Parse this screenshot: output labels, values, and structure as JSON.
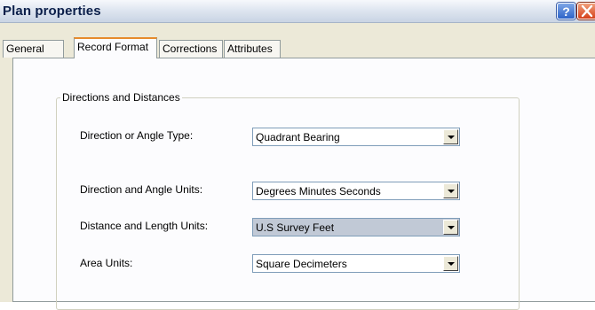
{
  "window": {
    "title": "Plan properties",
    "help_glyph": "?",
    "close_icon": "close-icon"
  },
  "tabs": [
    {
      "label": "General",
      "active": false
    },
    {
      "label": "Record Format",
      "active": true
    },
    {
      "label": "Corrections",
      "active": false
    },
    {
      "label": "Attributes",
      "active": false
    }
  ],
  "group": {
    "legend": "Directions and Distances",
    "rows": [
      {
        "label": "Direction or Angle Type:",
        "value": "Quadrant Bearing",
        "focused": false
      },
      {
        "label": "Direction and Angle Units:",
        "value": "Degrees Minutes Seconds",
        "focused": false
      },
      {
        "label": "Distance and Length Units:",
        "value": "U.S Survey Feet",
        "focused": true
      },
      {
        "label": "Area Units:",
        "value": "Square Decimeters",
        "focused": false
      }
    ]
  },
  "colors": {
    "tab_highlight": "#e68b2c",
    "focused_combo": "#c1c9d6",
    "close_button": "#d5401a",
    "help_button": "#2d63c8"
  }
}
